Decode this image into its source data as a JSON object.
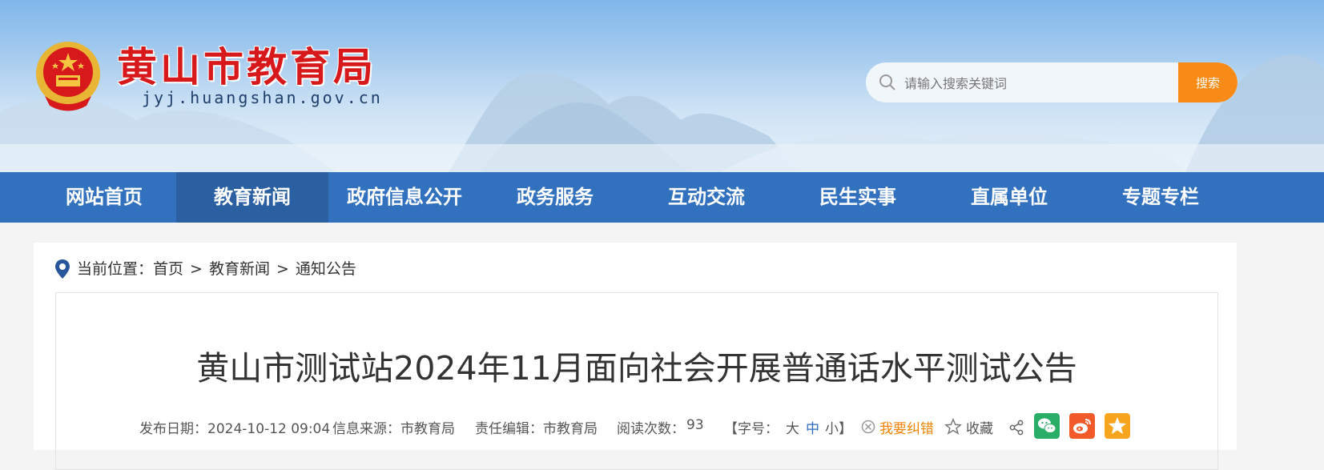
{
  "header": {
    "site_title": "黄山市教育局",
    "site_domain": "jyj.huangshan.gov.cn",
    "search": {
      "placeholder": "请输入搜索关键词",
      "button_label": "搜索"
    }
  },
  "nav": {
    "items": [
      {
        "label": "网站首页"
      },
      {
        "label": "教育新闻"
      },
      {
        "label": "政府信息公开"
      },
      {
        "label": "政务服务"
      },
      {
        "label": "互动交流"
      },
      {
        "label": "民生实事"
      },
      {
        "label": "直属单位"
      },
      {
        "label": "专题专栏"
      }
    ],
    "active_index": 1
  },
  "breadcrumb": {
    "prefix": "当前位置：",
    "items": [
      "首页",
      "教育新闻",
      "通知公告"
    ],
    "separator": ">"
  },
  "article": {
    "title": "黄山市测试站2024年11月面向社会开展普通话水平测试公告",
    "publish_label": "发布日期：2024-10-12 09:04",
    "source_label": "信息来源：市教育局",
    "editor_label": "责任编辑：市教育局",
    "views_label": "阅读次数：",
    "views": "93",
    "font_size": {
      "open": "【字号：",
      "large": "大",
      "medium": "中",
      "small": "小】"
    },
    "correction": "我要纠错",
    "favorite": "收藏"
  },
  "colors": {
    "nav_bg": "#3271bd",
    "nav_active": "#2a5fa2",
    "title_red": "#d7191c",
    "search_button": "#f78b15",
    "wechat": "#2aae67",
    "weibo": "#f25a29",
    "qzone": "#f7a51f"
  },
  "icons": [
    "search-icon",
    "location-pin-icon",
    "correct-icon",
    "star-icon",
    "share-icon",
    "wechat-icon",
    "weibo-icon",
    "qzone-icon"
  ]
}
